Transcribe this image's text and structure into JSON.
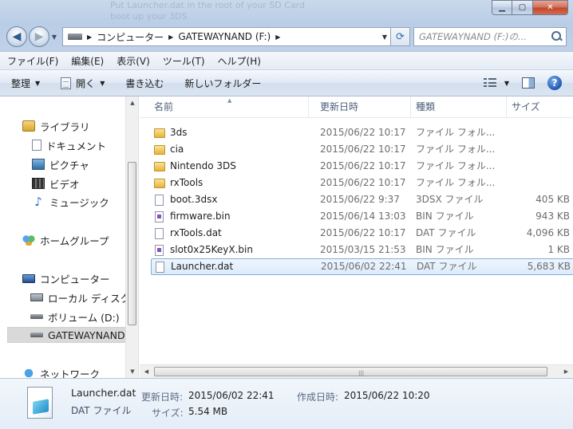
{
  "window": {
    "bg_text": [
      "Put Launcher.dat in the root of your SD Card",
      "boot up your 3DS"
    ]
  },
  "address": {
    "crumbs": [
      "コンピューター",
      "GATEWAYNAND (F:)"
    ],
    "search_placeholder": "GATEWAYNAND (F:)の..."
  },
  "menubar": [
    "ファイル(F)",
    "編集(E)",
    "表示(V)",
    "ツール(T)",
    "ヘルプ(H)"
  ],
  "commands": {
    "organize": "整理",
    "open": "開く",
    "burn": "書き込む",
    "new_folder": "新しいフォルダー"
  },
  "nav": {
    "libraries": "ライブラリ",
    "documents": "ドキュメント",
    "pictures": "ピクチャ",
    "videos": "ビデオ",
    "music": "ミュージック",
    "homegroup": "ホームグループ",
    "computer": "コンピューター",
    "local_disk": "ローカル ディスク",
    "volume_d": "ボリューム (D:)",
    "gatewaynand": "GATEWAYNAND",
    "network": "ネットワーク"
  },
  "columns": {
    "name": "名前",
    "date": "更新日時",
    "type": "種類",
    "size": "サイズ"
  },
  "files": [
    {
      "name": "3ds",
      "date": "2015/06/22 10:17",
      "type": "ファイル フォル...",
      "size": "",
      "kind": "folder"
    },
    {
      "name": "cia",
      "date": "2015/06/22 10:17",
      "type": "ファイル フォル...",
      "size": "",
      "kind": "folder"
    },
    {
      "name": "Nintendo 3DS",
      "date": "2015/06/22 10:17",
      "type": "ファイル フォル...",
      "size": "",
      "kind": "folder"
    },
    {
      "name": "rxTools",
      "date": "2015/06/22 10:17",
      "type": "ファイル フォル...",
      "size": "",
      "kind": "folder"
    },
    {
      "name": "boot.3dsx",
      "date": "2015/06/22 9:37",
      "type": "3DSX ファイル",
      "size": "405 KB",
      "kind": "file"
    },
    {
      "name": "firmware.bin",
      "date": "2015/06/14 13:03",
      "type": "BIN ファイル",
      "size": "943 KB",
      "kind": "bin"
    },
    {
      "name": "rxTools.dat",
      "date": "2015/06/22 10:17",
      "type": "DAT ファイル",
      "size": "4,096 KB",
      "kind": "file"
    },
    {
      "name": "slot0x25KeyX.bin",
      "date": "2015/03/15 21:53",
      "type": "BIN ファイル",
      "size": "1 KB",
      "kind": "bin"
    },
    {
      "name": "Launcher.dat",
      "date": "2015/06/02 22:41",
      "type": "DAT ファイル",
      "size": "5,683 KB",
      "kind": "file",
      "selected": true
    }
  ],
  "details": {
    "name": "Launcher.dat",
    "type": "DAT ファイル",
    "modified_label": "更新日時:",
    "modified_value": "2015/06/02 22:41",
    "created_label": "作成日時:",
    "created_value": "2015/06/22 10:20",
    "size_label": "サイズ:",
    "size_value": "5.54 MB"
  },
  "icons": {
    "back": "back-arrow-icon",
    "forward": "forward-arrow-icon",
    "refresh": "refresh-icon",
    "search": "search-icon",
    "help": "help-icon"
  }
}
